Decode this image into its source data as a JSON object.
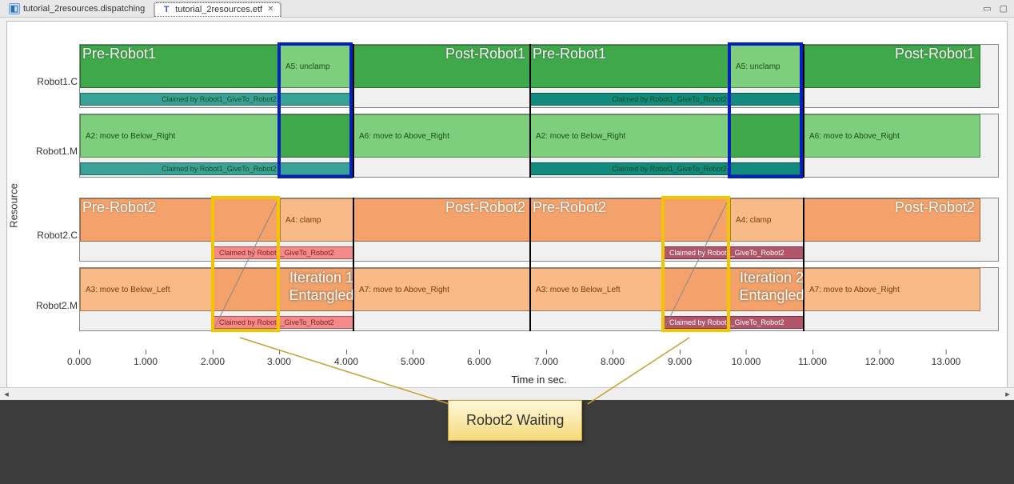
{
  "tabs": {
    "inactive": {
      "label": "tutorial_2resources.dispatching"
    },
    "active": {
      "label": "tutorial_2resources.etf",
      "iconLetter": "T"
    }
  },
  "chart": {
    "yAxisLabel": "Resource",
    "xAxisLabel": "Time in sec.",
    "rowLabels": [
      "Robot1.C",
      "Robot1.M",
      "Robot2.C",
      "Robot2.M"
    ],
    "phases": {
      "preRobot1": "Pre-Robot1",
      "postRobot1": "Post-Robot1",
      "preRobot2": "Pre-Robot2",
      "postRobot2": "Post-Robot2"
    },
    "entangled1": "Iteration 1 Entangled",
    "entangled2": "Iteration 2 Entangled",
    "barLabels": {
      "a2": "A2: move to Below_Right",
      "a5": "A5: unclamp",
      "a6": "A6: move to Above_Right",
      "claimed1": "Claimed by Robot1_GiveTo_Robot2",
      "a4": "A4: clamp",
      "a3": "A3: move to Below_Left",
      "a7": "A7: move to Above_Right",
      "claimed2": "Claimed by Robot1_GiveTo_Robot2"
    },
    "ticks": [
      "0.000",
      "1.000",
      "2.000",
      "3.000",
      "4.000",
      "5.000",
      "6.000",
      "7.000",
      "8.000",
      "9.000",
      "10.000",
      "11.000",
      "12.000",
      "13.000"
    ]
  },
  "callout": {
    "text": "Robot2 Waiting"
  },
  "chart_data": {
    "type": "gantt",
    "xlabel": "Time in sec.",
    "ylabel": "Resource",
    "xlim": [
      0,
      13.8
    ],
    "resources": [
      "Robot1.C",
      "Robot1.M",
      "Robot2.C",
      "Robot2.M"
    ],
    "phases": [
      {
        "name": "Pre-Robot1",
        "iteration": 1,
        "resourceGroup": "Robot1",
        "start": 0.0,
        "end": 3.0
      },
      {
        "name": "Post-Robot1",
        "iteration": 1,
        "resourceGroup": "Robot1",
        "start": 4.1,
        "end": 6.75
      },
      {
        "name": "Pre-Robot1",
        "iteration": 2,
        "resourceGroup": "Robot1",
        "start": 6.75,
        "end": 9.75
      },
      {
        "name": "Post-Robot1",
        "iteration": 2,
        "resourceGroup": "Robot1",
        "start": 10.85,
        "end": 13.5
      },
      {
        "name": "Pre-Robot2",
        "iteration": 1,
        "resourceGroup": "Robot2",
        "start": 0.0,
        "end": 2.0
      },
      {
        "name": "Post-Robot2",
        "iteration": 1,
        "resourceGroup": "Robot2",
        "start": 4.1,
        "end": 6.75
      },
      {
        "name": "Pre-Robot2",
        "iteration": 2,
        "resourceGroup": "Robot2",
        "start": 6.75,
        "end": 8.75
      },
      {
        "name": "Post-Robot2",
        "iteration": 2,
        "resourceGroup": "Robot2",
        "start": 10.85,
        "end": 13.5
      }
    ],
    "tasks": [
      {
        "resource": "Robot1.C",
        "label": "A5: unclamp",
        "start": 3.0,
        "end": 4.1,
        "iteration": 1
      },
      {
        "resource": "Robot1.C",
        "label": "Claimed by Robot1_GiveTo_Robot2",
        "start": 0.0,
        "end": 4.1,
        "iteration": 1,
        "strip": true
      },
      {
        "resource": "Robot1.M",
        "label": "A2: move to Below_Right",
        "start": 0.0,
        "end": 3.0,
        "iteration": 1
      },
      {
        "resource": "Robot1.M",
        "label": "A6: move to Above_Right",
        "start": 4.1,
        "end": 6.75,
        "iteration": 1
      },
      {
        "resource": "Robot1.M",
        "label": "Claimed by Robot1_GiveTo_Robot2",
        "start": 0.0,
        "end": 4.1,
        "iteration": 1,
        "strip": true
      },
      {
        "resource": "Robot2.C",
        "label": "A4: clamp",
        "start": 3.0,
        "end": 4.1,
        "iteration": 1
      },
      {
        "resource": "Robot2.C",
        "label": "Claimed by Robot1_GiveTo_Robot2",
        "start": 2.0,
        "end": 4.1,
        "iteration": 1,
        "strip": true
      },
      {
        "resource": "Robot2.M",
        "label": "A3: move to Below_Left",
        "start": 0.0,
        "end": 2.0,
        "iteration": 1
      },
      {
        "resource": "Robot2.M",
        "label": "A7: move to Above_Right",
        "start": 4.1,
        "end": 6.75,
        "iteration": 1
      },
      {
        "resource": "Robot2.M",
        "label": "Claimed by Robot1_GiveTo_Robot2",
        "start": 2.0,
        "end": 4.1,
        "iteration": 1,
        "strip": true
      },
      {
        "resource": "Robot1.C",
        "label": "A5: unclamp",
        "start": 9.75,
        "end": 10.85,
        "iteration": 2
      },
      {
        "resource": "Robot1.C",
        "label": "Claimed by Robot1_GiveTo_Robot2",
        "start": 6.75,
        "end": 10.85,
        "iteration": 2,
        "strip": true
      },
      {
        "resource": "Robot1.M",
        "label": "A2: move to Below_Right",
        "start": 6.75,
        "end": 9.75,
        "iteration": 2
      },
      {
        "resource": "Robot1.M",
        "label": "A6: move to Above_Right",
        "start": 10.85,
        "end": 13.5,
        "iteration": 2
      },
      {
        "resource": "Robot1.M",
        "label": "Claimed by Robot1_GiveTo_Robot2",
        "start": 6.75,
        "end": 10.85,
        "iteration": 2,
        "strip": true
      },
      {
        "resource": "Robot2.C",
        "label": "A4: clamp",
        "start": 9.75,
        "end": 10.85,
        "iteration": 2
      },
      {
        "resource": "Robot2.C",
        "label": "Claimed by Robot1_GiveTo_Robot2",
        "start": 8.75,
        "end": 10.85,
        "iteration": 2,
        "strip": true
      },
      {
        "resource": "Robot2.M",
        "label": "A3: move to Below_Left",
        "start": 6.75,
        "end": 8.75,
        "iteration": 2
      },
      {
        "resource": "Robot2.M",
        "label": "A7: move to Above_Right",
        "start": 10.85,
        "end": 13.5,
        "iteration": 2
      },
      {
        "resource": "Robot2.M",
        "label": "Claimed by Robot1_GiveTo_Robot2",
        "start": 8.75,
        "end": 10.85,
        "iteration": 2,
        "strip": true
      }
    ],
    "annotations": [
      {
        "type": "box",
        "color": "blue",
        "iteration": 1,
        "resourceGroup": "Robot1",
        "start": 3.0,
        "end": 4.1
      },
      {
        "type": "box",
        "color": "blue",
        "iteration": 2,
        "resourceGroup": "Robot1",
        "start": 9.75,
        "end": 10.85
      },
      {
        "type": "box",
        "color": "yellow",
        "iteration": 1,
        "resourceGroup": "Robot2",
        "start": 2.0,
        "end": 3.0,
        "label": "Robot2 Waiting"
      },
      {
        "type": "box",
        "color": "yellow",
        "iteration": 2,
        "resourceGroup": "Robot2",
        "start": 8.75,
        "end": 9.75,
        "label": "Robot2 Waiting"
      },
      {
        "type": "text",
        "iteration": 1,
        "text": "Iteration 1 Entangled"
      },
      {
        "type": "text",
        "iteration": 2,
        "text": "Iteration 2 Entangled"
      }
    ]
  }
}
